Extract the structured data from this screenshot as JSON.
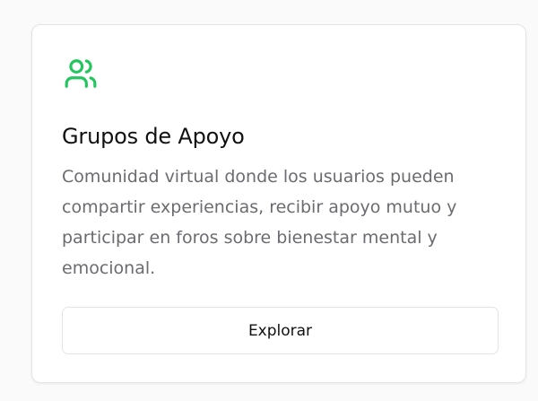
{
  "card": {
    "icon": "users-icon",
    "icon_color": "#22c55e",
    "title": "Grupos de Apoyo",
    "description": "Comunidad virtual donde los usuarios pueden compartir experiencias, recibir apoyo mutuo y participar en foros sobre bienestar mental y emocional.",
    "button_label": "Explorar"
  }
}
